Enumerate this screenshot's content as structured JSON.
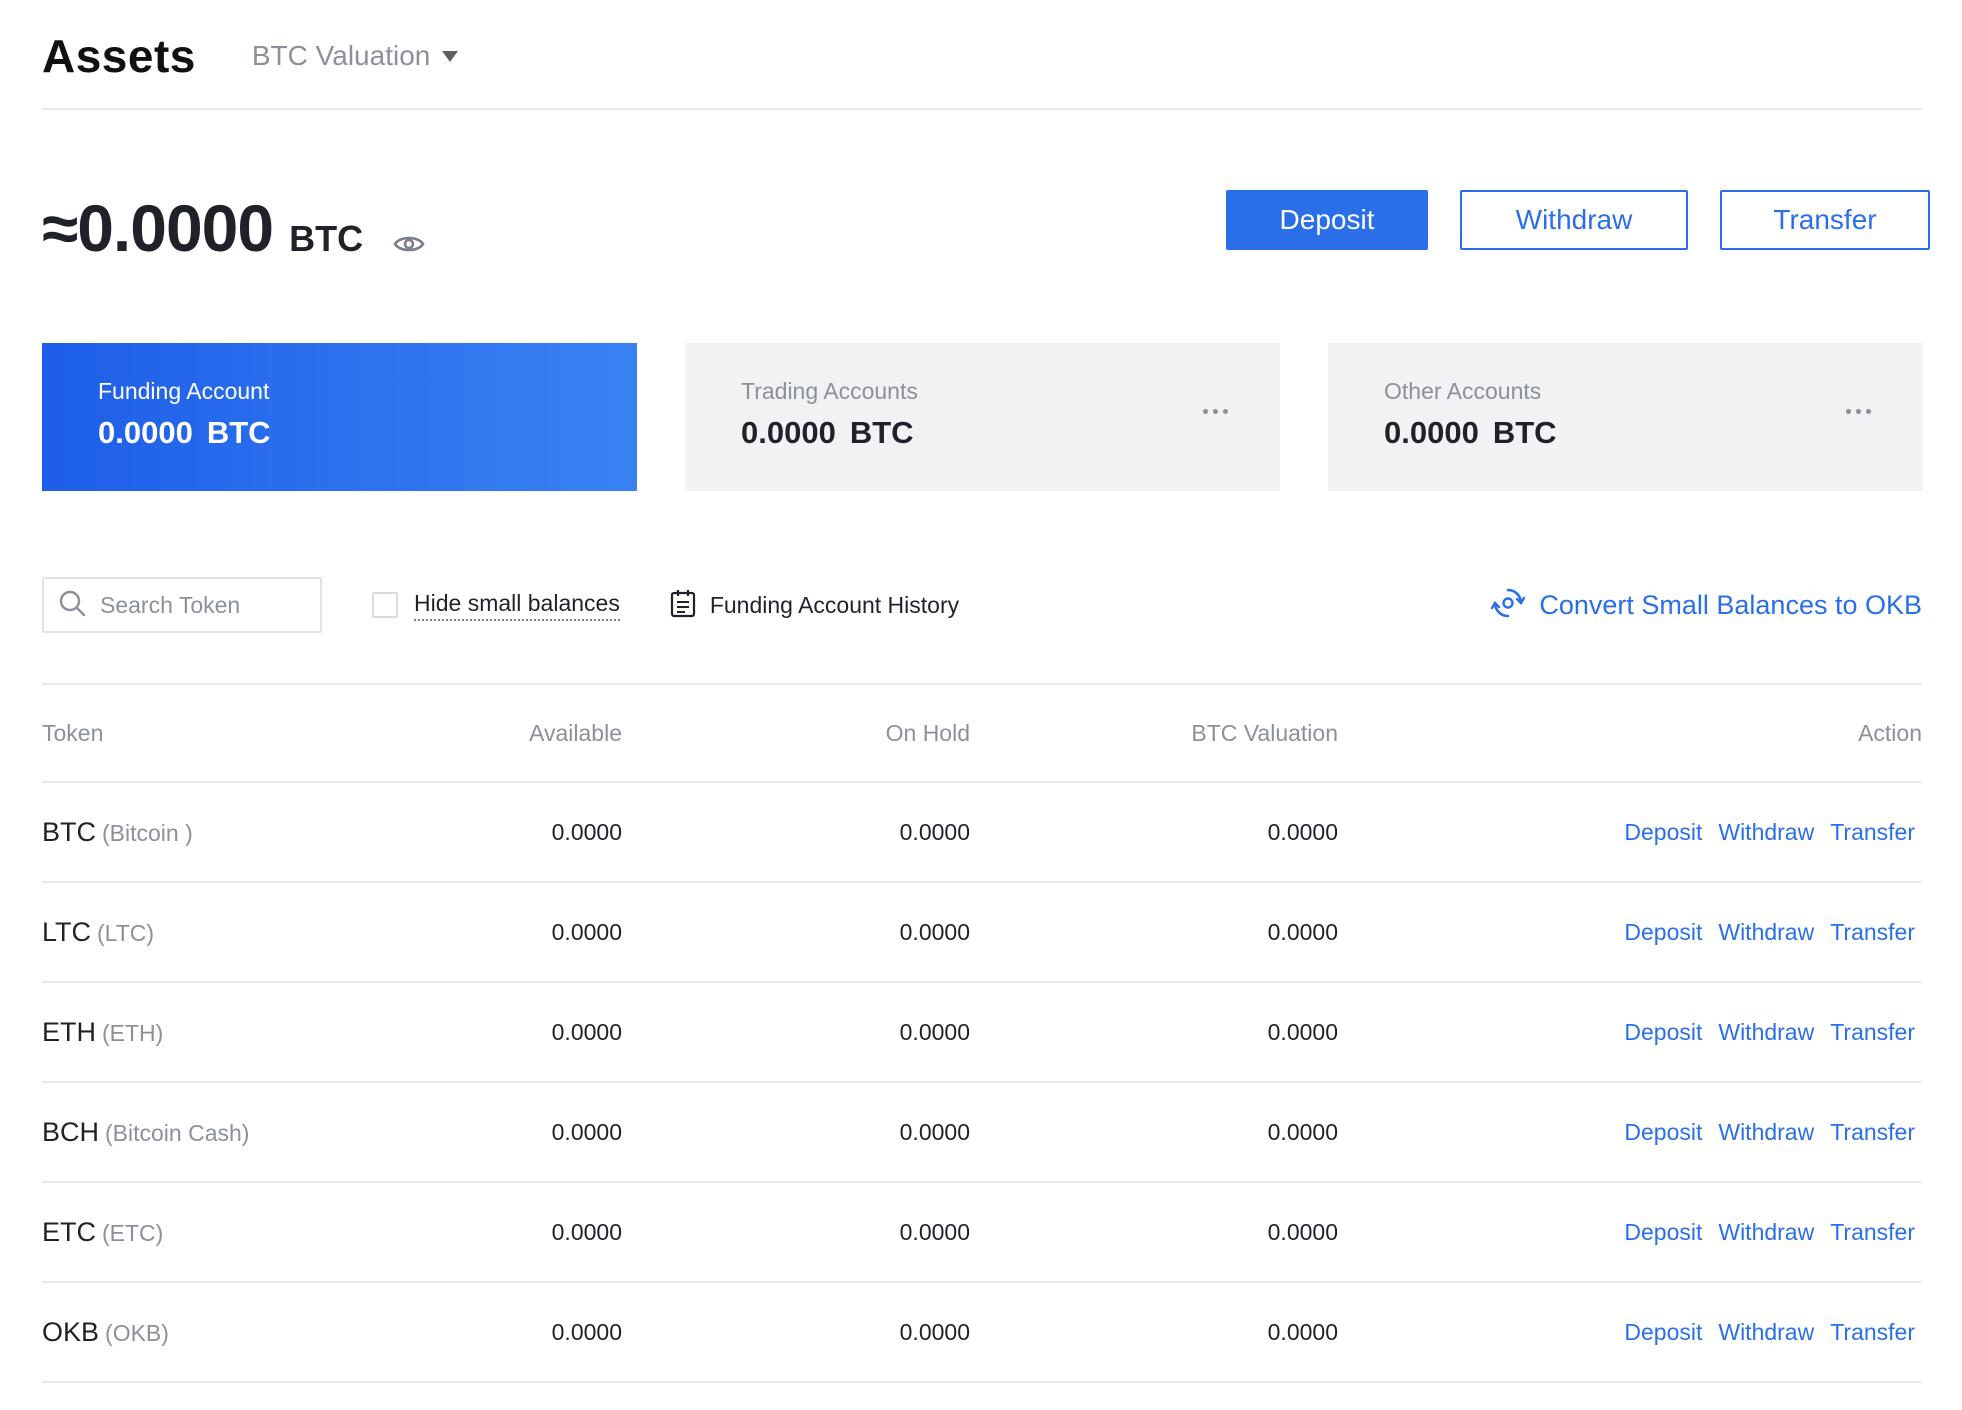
{
  "header": {
    "title": "Assets",
    "valuation_selector": "BTC Valuation"
  },
  "balance": {
    "amount": "≈0.0000",
    "unit": "BTC"
  },
  "top_actions": {
    "deposit": "Deposit",
    "withdraw": "Withdraw",
    "transfer": "Transfer"
  },
  "accounts": [
    {
      "label": "Funding Account",
      "value": "0.0000",
      "unit": "BTC"
    },
    {
      "label": "Trading Accounts",
      "value": "0.0000",
      "unit": "BTC"
    },
    {
      "label": "Other Accounts",
      "value": "0.0000",
      "unit": "BTC"
    }
  ],
  "toolbar": {
    "search_placeholder": "Search Token",
    "hide_small": "Hide small balances",
    "history": "Funding Account History",
    "convert": "Convert Small Balances to OKB"
  },
  "table": {
    "headers": {
      "token": "Token",
      "available": "Available",
      "on_hold": "On Hold",
      "btc_valuation": "BTC Valuation",
      "action": "Action"
    },
    "actions": {
      "deposit": "Deposit",
      "withdraw": "Withdraw",
      "transfer": "Transfer"
    },
    "rows": [
      {
        "symbol": "BTC",
        "name": "(Bitcoin )",
        "available": "0.0000",
        "on_hold": "0.0000",
        "btc_valuation": "0.0000"
      },
      {
        "symbol": "LTC",
        "name": "(LTC)",
        "available": "0.0000",
        "on_hold": "0.0000",
        "btc_valuation": "0.0000"
      },
      {
        "symbol": "ETH",
        "name": "(ETH)",
        "available": "0.0000",
        "on_hold": "0.0000",
        "btc_valuation": "0.0000"
      },
      {
        "symbol": "BCH",
        "name": "(Bitcoin Cash)",
        "available": "0.0000",
        "on_hold": "0.0000",
        "btc_valuation": "0.0000"
      },
      {
        "symbol": "ETC",
        "name": "(ETC)",
        "available": "0.0000",
        "on_hold": "0.0000",
        "btc_valuation": "0.0000"
      },
      {
        "symbol": "OKB",
        "name": "(OKB)",
        "available": "0.0000",
        "on_hold": "0.0000",
        "btc_valuation": "0.0000"
      }
    ]
  },
  "colors": {
    "accent": "#2b6fe8",
    "card_active_start": "#1e5ee8",
    "card_active_end": "#3a82f2",
    "card_inactive": "#f1f2f4",
    "muted_text": "#8b9099"
  }
}
